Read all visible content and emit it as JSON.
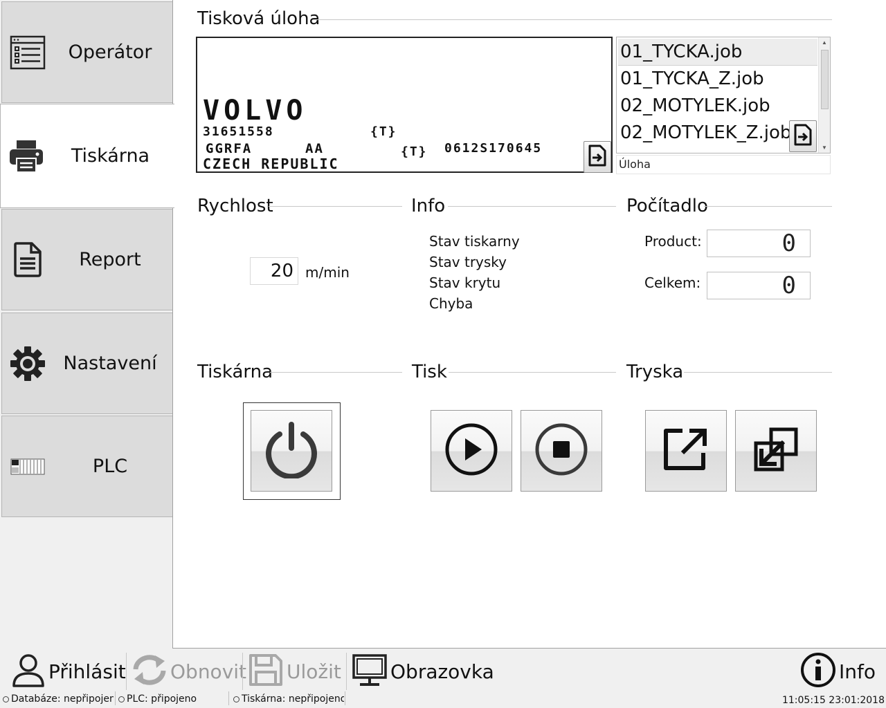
{
  "sidebar": {
    "items": [
      {
        "label": "Operátor",
        "icon": "list-icon"
      },
      {
        "label": "Tiskárna",
        "icon": "printer-icon",
        "active": true
      },
      {
        "label": "Report",
        "icon": "document-icon"
      },
      {
        "label": "Nastavení",
        "icon": "gear-icon"
      },
      {
        "label": "PLC",
        "icon": "plc-icon"
      }
    ]
  },
  "print_job": {
    "title": "Tisková úloha",
    "preview": {
      "line1": "VOLVO",
      "line2": "31651558",
      "token1": "{T}",
      "line3a": "GGRFA",
      "line3b": "AA",
      "token2": "{T}",
      "line3c": "0612S170645",
      "line4": "CZECH  REPUBLIC"
    },
    "jobs": [
      "01_TYCKA.job",
      "01_TYCKA_Z.job",
      "02_MOTYLEK.job",
      "02_MOTYLEK_Z.job"
    ],
    "selected_job_index": 0,
    "list_label": "Úloha"
  },
  "speed": {
    "title": "Rychlost",
    "value": "20",
    "unit": "m/min"
  },
  "info": {
    "title": "Info",
    "items": [
      "Stav tiskarny",
      "Stav trysky",
      "Stav krytu",
      "Chyba"
    ]
  },
  "counter": {
    "title": "Počítadlo",
    "product_label": "Product:",
    "product_value": "0",
    "total_label": "Celkem:",
    "total_value": "0"
  },
  "printer_section": {
    "title": "Tiskárna"
  },
  "print_section": {
    "title": "Tisk"
  },
  "nozzle_section": {
    "title": "Tryska"
  },
  "toolbar": {
    "login": "Přihlásit",
    "refresh": "Obnovit",
    "save": "Uložit",
    "screen": "Obrazovka",
    "info": "Info"
  },
  "status": {
    "database": "Databáze: nepřipojeno",
    "plc": "PLC: připojeno",
    "printer": "Tiskárna: nepřipojeno",
    "datetime": "11:05:15 23:01:2018"
  },
  "colors": {
    "sidebar_bg": "#dcdcdc",
    "active_bg": "#ffffff",
    "disabled_text": "#9a9a9a"
  }
}
